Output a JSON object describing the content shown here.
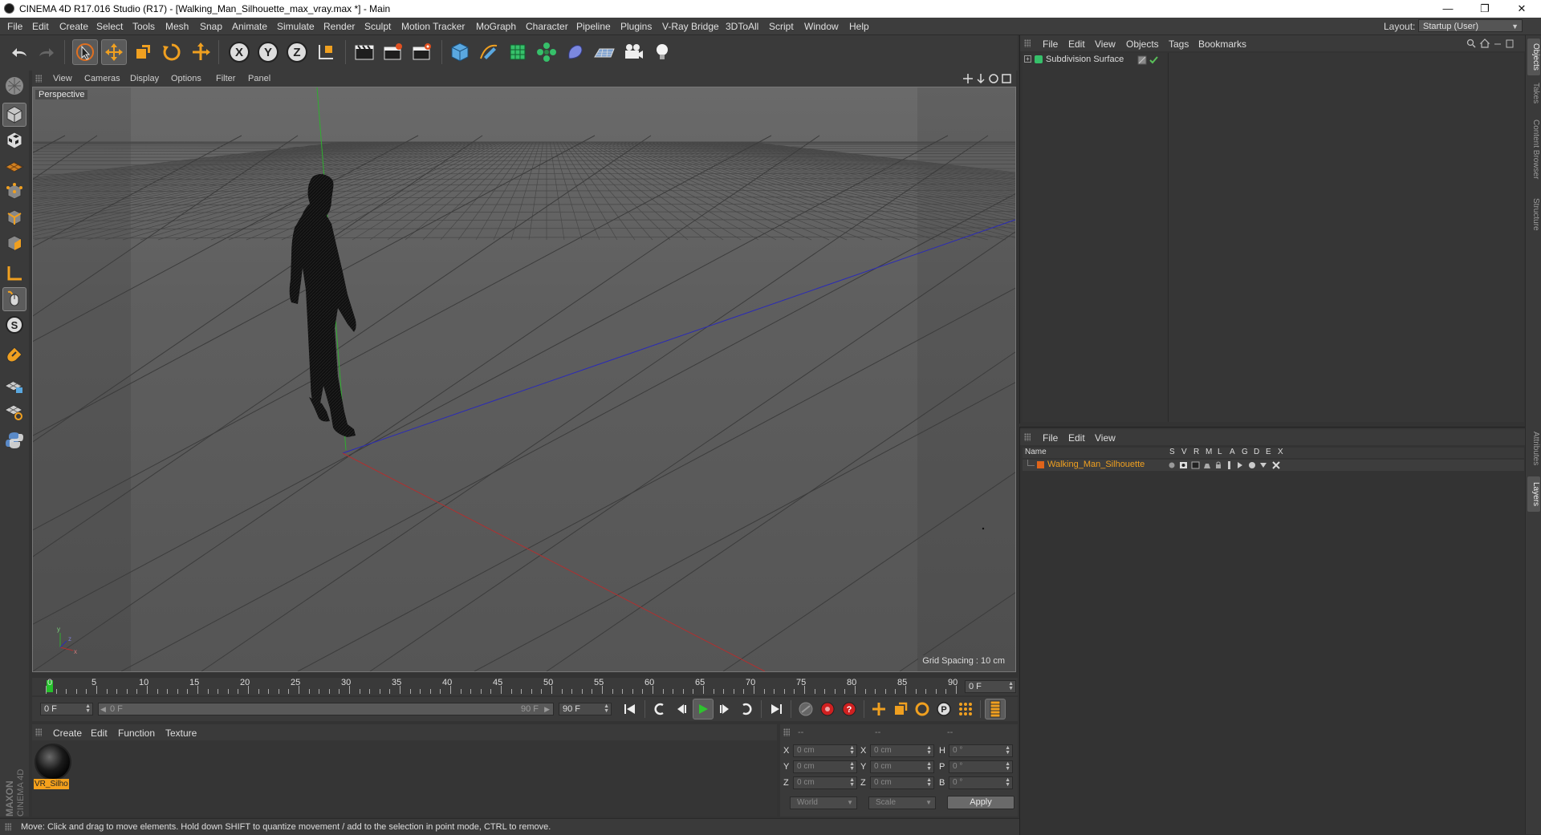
{
  "window": {
    "title": "CINEMA 4D R17.016 Studio (R17) - [Walking_Man_Silhouette_max_vray.max *] - Main",
    "minimize": "—",
    "restore": "❐",
    "close": "✕"
  },
  "menu": [
    "File",
    "Edit",
    "Create",
    "Select",
    "Tools",
    "Mesh",
    "Snap",
    "Animate",
    "Simulate",
    "Render",
    "Sculpt",
    "Motion Tracker",
    "MoGraph",
    "Character",
    "Pipeline",
    "Plugins",
    "V-Ray Bridge",
    "3DToAll",
    "Script",
    "Window",
    "Help"
  ],
  "layout": {
    "label": "Layout:",
    "value": "Startup (User)"
  },
  "toolbar": {
    "icons": [
      "undo-icon",
      "redo-icon",
      "select-icon",
      "move-icon",
      "scale-icon",
      "rotate-icon",
      "transform-icon",
      "x-axis-icon",
      "y-axis-icon",
      "z-axis-icon",
      "coordinate-system-icon",
      "render-view-icon",
      "render-picture-viewer-icon",
      "render-settings-icon",
      "cube-icon",
      "pen-icon",
      "subdivision-icon",
      "cloner-icon",
      "deformer-icon",
      "floor-icon",
      "camera-icon",
      "light-icon"
    ]
  },
  "left_palette": [
    "make-editable-icon",
    "model-mode-icon",
    "texture-mode-icon",
    "workplane-icon",
    "points-mode-icon",
    "edges-mode-icon",
    "polygons-mode-icon",
    "axis-icon",
    "tweak-icon",
    "snap-icon",
    "magnet-icon",
    "lock-workplane-icon",
    "planar-workplane-icon",
    "python-icon"
  ],
  "viewport": {
    "menu": [
      "View",
      "Cameras",
      "Display",
      "Options",
      "Filter",
      "Panel"
    ],
    "label": "Perspective",
    "grid_spacing": "Grid Spacing : 10 cm",
    "axis_colors": {
      "x": "#b03030",
      "y": "#2fae2f",
      "z": "#2a2ab8"
    }
  },
  "timeline": {
    "ticks": [
      "0",
      "5",
      "10",
      "15",
      "20",
      "25",
      "30",
      "35",
      "40",
      "45",
      "50",
      "55",
      "60",
      "65",
      "70",
      "75",
      "80",
      "85",
      "90"
    ],
    "current_frame": "0 F",
    "start_field": "0 F",
    "range_start": "0 F",
    "range_end": "90 F",
    "end_field": "90 F"
  },
  "materials": {
    "menu": [
      "Create",
      "Edit",
      "Function",
      "Texture"
    ],
    "items": [
      {
        "name": "VR_Silho"
      }
    ]
  },
  "coordinates": {
    "headers": [
      "--",
      "--",
      "--"
    ],
    "rows": [
      {
        "l1": "X",
        "v1": "0 cm",
        "l2": "X",
        "v2": "0 cm",
        "l3": "H",
        "v3": "0 °"
      },
      {
        "l1": "Y",
        "v1": "0 cm",
        "l2": "Y",
        "v2": "0 cm",
        "l3": "P",
        "v3": "0 °"
      },
      {
        "l1": "Z",
        "v1": "0 cm",
        "l2": "Z",
        "v2": "0 cm",
        "l3": "B",
        "v3": "0 °"
      }
    ],
    "world": "World",
    "scale": "Scale",
    "apply": "Apply"
  },
  "status": "Move: Click and drag to move elements. Hold down SHIFT to quantize movement / add to the selection in point mode, CTRL to remove.",
  "objects_panel": {
    "menu": [
      "File",
      "Edit",
      "View",
      "Objects",
      "Tags",
      "Bookmarks"
    ],
    "items": [
      {
        "name": "Subdivision Surface"
      }
    ]
  },
  "layers_panel": {
    "menu": [
      "File",
      "Edit",
      "View"
    ],
    "columns": [
      "Name",
      "S",
      "V",
      "R",
      "M",
      "L",
      "A",
      "G",
      "D",
      "E",
      "X"
    ],
    "rows": [
      {
        "name": "Walking_Man_Silhouette",
        "color": "#e0641a"
      }
    ]
  },
  "side_tabs": [
    "Objects",
    "Takes",
    "Content Browser",
    "Structure",
    "Attributes",
    "Layers"
  ],
  "brand": {
    "line1": "MAXON",
    "line2": "CINEMA 4D"
  }
}
